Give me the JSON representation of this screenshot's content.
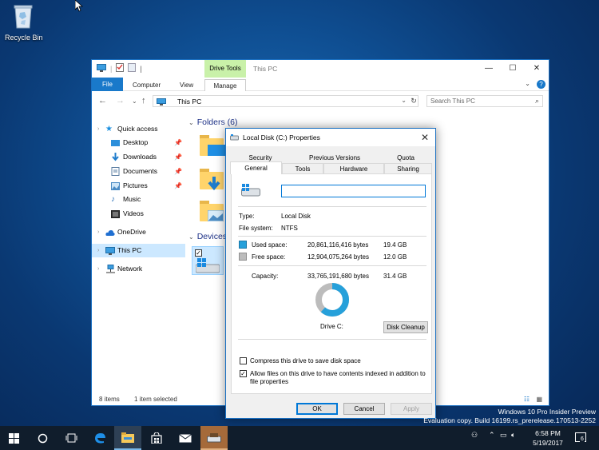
{
  "desktop": {
    "recycle_bin_label": "Recycle Bin"
  },
  "explorer": {
    "title": "This PC",
    "contextual_tab": "Drive Tools",
    "ribbon_tabs": [
      "File",
      "Computer",
      "View",
      "Manage"
    ],
    "address": "This PC",
    "search_placeholder": "Search This PC",
    "nav": {
      "quick_access": "Quick access",
      "desktop": "Desktop",
      "downloads": "Downloads",
      "documents": "Documents",
      "pictures": "Pictures",
      "music": "Music",
      "videos": "Videos",
      "onedrive": "OneDrive",
      "this_pc": "This PC",
      "network": "Network"
    },
    "folders_header": "Folders (6)",
    "devices_header": "Devices",
    "status": {
      "items": "8 items",
      "selected": "1 item selected"
    }
  },
  "dialog": {
    "title": "Local Disk (C:) Properties",
    "tabs_row1": [
      "Security",
      "Previous Versions",
      "Quota"
    ],
    "tabs_row2": [
      "General",
      "Tools",
      "Hardware",
      "Sharing"
    ],
    "active_tab": "General",
    "drive_name_value": "",
    "type_label": "Type:",
    "type_value": "Local Disk",
    "fs_label": "File system:",
    "fs_value": "NTFS",
    "used_label": "Used space:",
    "used_bytes": "20,861,116,416 bytes",
    "used_gb": "19.4 GB",
    "free_label": "Free space:",
    "free_bytes": "12,904,075,264 bytes",
    "free_gb": "12.0 GB",
    "capacity_label": "Capacity:",
    "capacity_bytes": "33,765,191,680 bytes",
    "capacity_gb": "31.4 GB",
    "drive_label": "Drive C:",
    "disk_cleanup": "Disk Cleanup",
    "compress_label": "Compress this drive to save disk space",
    "compress_checked": false,
    "index_label_1": "Allow files on this drive to have contents indexed in addition to",
    "index_label_2": "file properties",
    "index_checked": true,
    "ok": "OK",
    "cancel": "Cancel",
    "apply": "Apply",
    "used_fraction": 0.618,
    "colors": {
      "used": "#26a0da",
      "free": "#bcbcbc"
    }
  },
  "watermark": {
    "line1": "Windows 10 Pro Insider Preview",
    "line2": "Evaluation copy. Build 16199.rs_prerelease.170513-2252"
  },
  "taskbar": {
    "time": "6:58 PM",
    "date": "5/19/2017",
    "notification_count": "6"
  }
}
